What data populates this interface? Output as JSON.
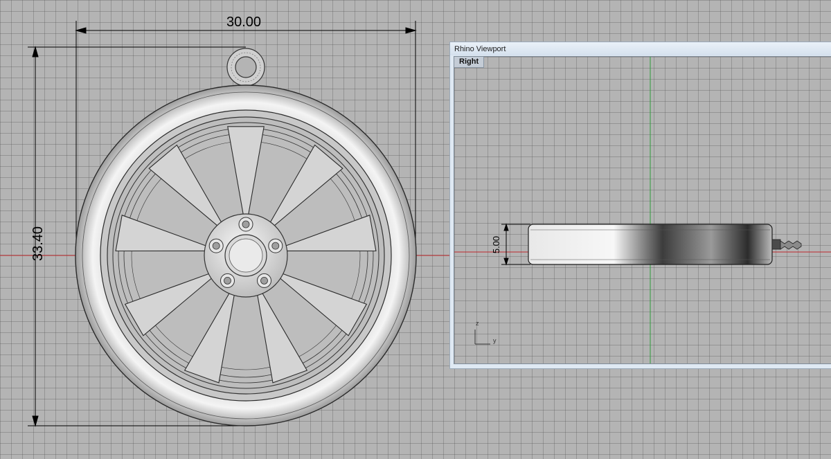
{
  "dimensions": {
    "width_label": "30.00",
    "height_label": "33.40",
    "thickness_label": "5.00"
  },
  "side_window": {
    "title": "Rhino Viewport",
    "tab_label": "Right",
    "axis_z": "z",
    "axis_y": "y"
  },
  "colors": {
    "background": "#b4b4b4",
    "grid": "#585858",
    "x_axis": "#c0282d",
    "y_axis": "#2e9b3b",
    "window_frame": "#dfe9f3"
  }
}
